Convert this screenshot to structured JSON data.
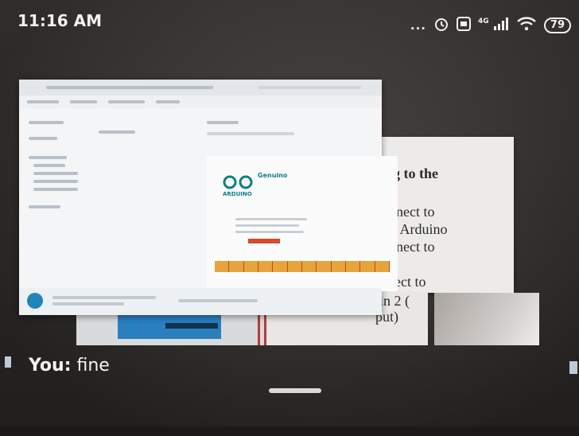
{
  "status_bar": {
    "time": "11:16 AM",
    "dots": "...",
    "network": "4G",
    "battery": "79"
  },
  "paper_text": {
    "line1": "g to the",
    "line2": "nect to",
    "line3": ": Arduino",
    "line4": "nect  to",
    "line5": "ect to",
    "line6": "pin 2 (",
    "line7": "put)"
  },
  "splash": {
    "brand": "Genuino",
    "sub": "ARDUINO"
  },
  "chat": {
    "sender": "You:",
    "message": "fine"
  },
  "icons": {
    "alarm": "alarm-icon",
    "volte": "volte-icon",
    "signal": "signal-icon",
    "wifi": "wifi-icon"
  }
}
